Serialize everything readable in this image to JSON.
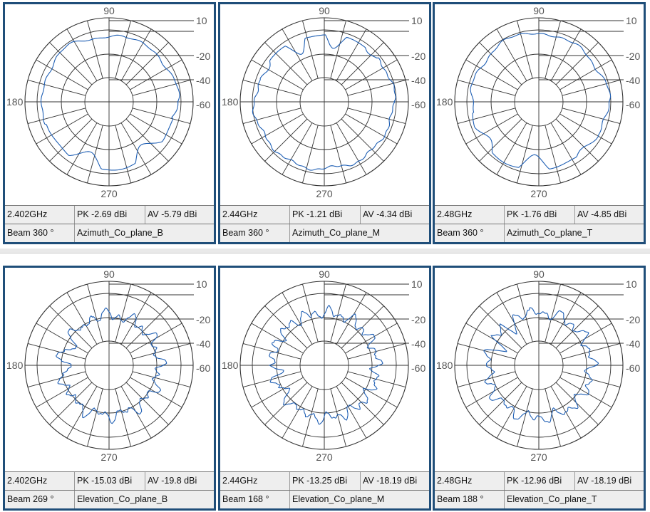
{
  "chart_data": [
    {
      "type": "polar",
      "frequency": "2.402GHz",
      "peak": "PK -2.69 dBi",
      "average": "AV -5.79 dBi",
      "beam": "Beam 360 °",
      "name": "Azimuth_Co_plane_B",
      "angle_labels": [
        "90",
        "180",
        "270"
      ],
      "radial_labels": [
        "10",
        "-20",
        "-40",
        "-60"
      ],
      "ring_levels_dBi": [
        10,
        0,
        -20,
        -40,
        -60
      ],
      "pattern": {
        "base_dBi": -4,
        "ripple": [
          {
            "k": 6,
            "amp": 1.5,
            "phase": 0.7,
            "window": [
              200,
              345
            ],
            "wamp": 14
          },
          {
            "k": 3,
            "amp": 1.0,
            "phase": 0.3
          }
        ]
      }
    },
    {
      "type": "polar",
      "frequency": "2.44GHz",
      "peak": "PK -1.21 dBi",
      "average": "AV -4.34 dBi",
      "beam": "Beam 360 °",
      "name": "Azimuth_Co_plane_M",
      "angle_labels": [
        "90",
        "180",
        "270"
      ],
      "radial_labels": [
        "10",
        "-20",
        "-40",
        "-60"
      ],
      "ring_levels_dBi": [
        10,
        0,
        -20,
        -40,
        -60
      ],
      "pattern": {
        "base_dBi": -3,
        "ripple": [
          {
            "k": 10,
            "amp": 1.2,
            "phase": 0.2,
            "window": [
              40,
              160
            ],
            "wamp": 13
          },
          {
            "k": 2,
            "amp": 1.0,
            "phase": 1.2
          }
        ]
      }
    },
    {
      "type": "polar",
      "frequency": "2.48GHz",
      "peak": "PK -1.76 dBi",
      "average": "AV -4.85 dBi",
      "beam": "Beam 360 °",
      "name": "Azimuth_Co_plane_T",
      "angle_labels": [
        "90",
        "180",
        "270"
      ],
      "radial_labels": [
        "10",
        "-20",
        "-40",
        "-60"
      ],
      "ring_levels_dBi": [
        10,
        0,
        -20,
        -40,
        -60
      ],
      "pattern": {
        "base_dBi": -3,
        "ripple": [
          {
            "k": 7,
            "amp": 1.3,
            "phase": 0.5,
            "window": [
              190,
              330
            ],
            "wamp": 12
          },
          {
            "k": 3,
            "amp": 1.0,
            "phase": 2.0
          }
        ]
      }
    },
    {
      "type": "polar",
      "frequency": "2.402GHz",
      "peak": "PK -15.03 dBi",
      "average": "AV -19.8 dBi",
      "beam": "Beam 269 °",
      "name": "Elevation_Co_plane_B",
      "angle_labels": [
        "90",
        "180",
        "270"
      ],
      "radial_labels": [
        "10",
        "-20",
        "-40",
        "-60"
      ],
      "ring_levels_dBi": [
        10,
        0,
        -20,
        -40,
        -60
      ],
      "pattern": {
        "base_dBi": -18,
        "ripple": [
          {
            "k": 24,
            "amp": 3.0,
            "phase": 0.0
          },
          {
            "k": 12,
            "amp": 3.0,
            "phase": 1.0,
            "window": [
              110,
              220
            ],
            "wamp": 14
          }
        ]
      }
    },
    {
      "type": "polar",
      "frequency": "2.44GHz",
      "peak": "PK -13.25 dBi",
      "average": "AV -18.19 dBi",
      "beam": "Beam 168 °",
      "name": "Elevation_Co_plane_M",
      "angle_labels": [
        "90",
        "180",
        "270"
      ],
      "radial_labels": [
        "10",
        "-20",
        "-40",
        "-60"
      ],
      "ring_levels_dBi": [
        10,
        0,
        -20,
        -40,
        -60
      ],
      "pattern": {
        "base_dBi": -16,
        "ripple": [
          {
            "k": 26,
            "amp": 3.0,
            "phase": 0.4
          },
          {
            "k": 14,
            "amp": 2.5,
            "phase": 0.0,
            "window": [
              160,
              250
            ],
            "wamp": 10
          }
        ]
      }
    },
    {
      "type": "polar",
      "frequency": "2.48GHz",
      "peak": "PK -12.96 dBi",
      "average": "AV -18.19 dBi",
      "beam": "Beam 188 °",
      "name": "Elevation_Co_plane_T",
      "angle_labels": [
        "90",
        "180",
        "270"
      ],
      "radial_labels": [
        "10",
        "-20",
        "-40",
        "-60"
      ],
      "ring_levels_dBi": [
        10,
        0,
        -20,
        -40,
        -60
      ],
      "pattern": {
        "base_dBi": -16,
        "ripple": [
          {
            "k": 22,
            "amp": 3.0,
            "phase": 0.9
          },
          {
            "k": 12,
            "amp": 2.5,
            "phase": 0.4,
            "window": [
              100,
              200
            ],
            "wamp": 12
          }
        ]
      }
    }
  ],
  "panels": [
    {
      "frequency": "2.402GHz",
      "peak": "PK -2.69 dBi",
      "average": "AV -5.79 dBi",
      "beam": "Beam 360 °",
      "name": "Azimuth_Co_plane_B"
    },
    {
      "frequency": "2.44GHz",
      "peak": "PK -1.21 dBi",
      "average": "AV -4.34 dBi",
      "beam": "Beam 360 °",
      "name": "Azimuth_Co_plane_M"
    },
    {
      "frequency": "2.48GHz",
      "peak": "PK -1.76 dBi",
      "average": "AV -4.85 dBi",
      "beam": "Beam 360 °",
      "name": "Azimuth_Co_plane_T"
    },
    {
      "frequency": "2.402GHz",
      "peak": "PK -15.03 dBi",
      "average": "AV -19.8 dBi",
      "beam": "Beam 269 °",
      "name": "Elevation_Co_plane_B"
    },
    {
      "frequency": "2.44GHz",
      "peak": "PK -13.25 dBi",
      "average": "AV -18.19 dBi",
      "beam": "Beam 168 °",
      "name": "Elevation_Co_plane_M"
    },
    {
      "frequency": "2.48GHz",
      "peak": "PK -12.96 dBi",
      "average": "AV -18.19 dBi",
      "beam": "Beam 188 °",
      "name": "Elevation_Co_plane_T"
    }
  ],
  "colors": {
    "trace": "#1f5fb4",
    "grid": "#333333",
    "frame": "#1f4e79",
    "cell_bg": "#eeeeee"
  }
}
